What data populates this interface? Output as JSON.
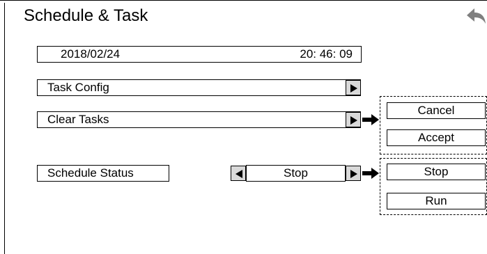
{
  "header": {
    "title": "Schedule & Task",
    "back_icon": "back-arrow-icon"
  },
  "datetime": {
    "date": "2018/02/24",
    "time": "20: 46: 09"
  },
  "menu": {
    "task_config": "Task Config",
    "clear_tasks": "Clear Tasks"
  },
  "clear_tasks_options": [
    "Cancel",
    "Accept"
  ],
  "schedule": {
    "label": "Schedule Status",
    "value": "Stop",
    "options": [
      "Stop",
      "Run"
    ]
  }
}
